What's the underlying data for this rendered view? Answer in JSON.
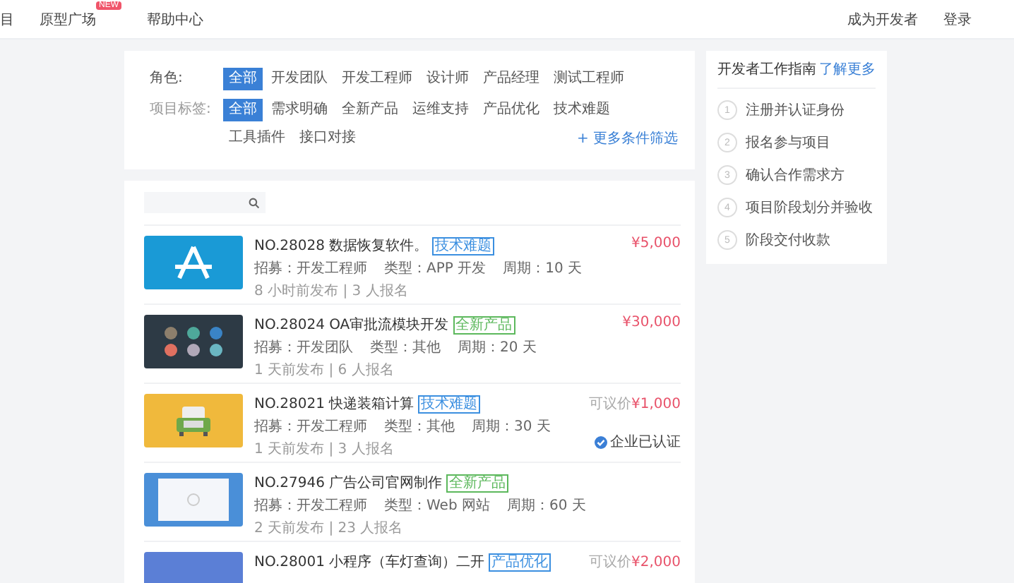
{
  "nav": {
    "left": [
      {
        "label": "目"
      },
      {
        "label": "原型广场",
        "badge": "NEW"
      },
      {
        "label": "帮助中心"
      }
    ],
    "right": [
      "成为开发者",
      "登录"
    ]
  },
  "filters": [
    {
      "label": "角色:",
      "options": [
        {
          "label": "全部",
          "selected": true
        },
        {
          "label": "开发团队",
          "selected": false
        },
        {
          "label": "开发工程师",
          "selected": false
        },
        {
          "label": "设计师",
          "selected": false
        },
        {
          "label": "产品经理",
          "selected": false
        },
        {
          "label": "测试工程师",
          "selected": false
        }
      ]
    },
    {
      "label": "项目标签:",
      "options": [
        {
          "label": "全部",
          "selected": true
        },
        {
          "label": "需求明确",
          "selected": false
        },
        {
          "label": "全新产品",
          "selected": false
        },
        {
          "label": "运维支持",
          "selected": false
        },
        {
          "label": "产品优化",
          "selected": false
        },
        {
          "label": "技术难题",
          "selected": false
        },
        {
          "label": "工具插件",
          "selected": false
        },
        {
          "label": "接口对接",
          "selected": false
        }
      ]
    }
  ],
  "more_filters": "+ 更多条件筛选",
  "rows": [
    {
      "kind": "app",
      "title": "NO.28028 数据恢复软件。",
      "tag": {
        "label": "技术难题",
        "color": "#3b8fe0"
      },
      "meta": [
        "招募：开发工程师",
        "类型：APP 开发",
        "周期：10 天"
      ],
      "posted": "8 小时前发布 | 3 人报名",
      "price_prefix": null,
      "price": "¥5,000",
      "certification": null
    },
    {
      "kind": "dashboard",
      "title": "NO.28024 OA审批流模块开发",
      "tag": {
        "label": "全新产品",
        "color": "#5cb85c"
      },
      "meta": [
        "招募：开发团队",
        "类型：其他",
        "周期：20 天"
      ],
      "posted": "1 天前发布 | 6 人报名",
      "price_prefix": null,
      "price": "¥30,000",
      "certification": null
    },
    {
      "kind": "sofa",
      "title": "NO.28021 快递装箱计算",
      "tag": {
        "label": "技术难题",
        "color": "#3b8fe0"
      },
      "meta": [
        "招募：开发工程师",
        "类型：其他",
        "周期：30 天"
      ],
      "posted": "1 天前发布 | 3 人报名",
      "price_prefix": "可议价",
      "price": "¥1,000",
      "certification": "企业已认证"
    },
    {
      "kind": "window",
      "title": "NO.27946 广告公司官网制作",
      "tag": {
        "label": "全新产品",
        "color": "#5cb85c"
      },
      "meta": [
        "招募：开发工程师",
        "类型：Web 网站",
        "周期：60 天"
      ],
      "posted": "2 天前发布 | 23 人报名",
      "price_prefix": null,
      "price": null,
      "certification": null
    },
    {
      "kind": "plain",
      "title": "NO.28001 小程序（车灯查询）二开",
      "tag": {
        "label": "产品优化",
        "color": "#3b8fe0"
      },
      "meta": [],
      "posted": null,
      "price_prefix": "可议价",
      "price": "¥2,000",
      "certification": null
    }
  ],
  "guide": {
    "title": "开发者工作指南",
    "link": "了解更多",
    "steps": [
      {
        "number": "1",
        "label": "注册并认证身份"
      },
      {
        "number": "2",
        "label": "报名参与项目"
      },
      {
        "number": "3",
        "label": "确认合作需求方"
      },
      {
        "number": "4",
        "label": "项目阶段划分并验收"
      },
      {
        "number": "5",
        "label": "阶段交付收款"
      }
    ]
  }
}
